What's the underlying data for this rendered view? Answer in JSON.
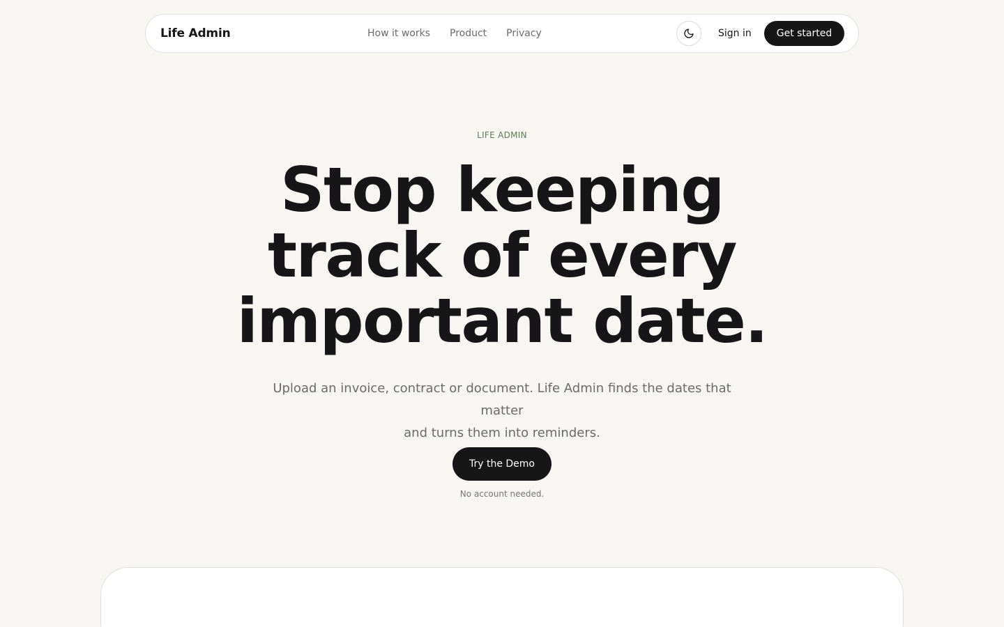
{
  "nav": {
    "brand": "Life Admin",
    "links": [
      "How it works",
      "Product",
      "Privacy"
    ],
    "theme_icon": "moon-icon",
    "sign_in": "Sign in",
    "get_started": "Get started"
  },
  "hero": {
    "eyebrow": "LIFE ADMIN",
    "headline_lines": [
      "Stop keeping",
      "track of every",
      "important date."
    ],
    "subtitle_lines": [
      "Upload an invoice, contract or document. Life Admin finds the dates that matter",
      "and turns them into reminders."
    ],
    "cta": "Try the Demo",
    "cta_note": "No account needed."
  },
  "colors": {
    "background": "#f7f6f3",
    "text": "#161616",
    "muted": "#6b6b6b",
    "accent": "#5f7a55",
    "button": "#161616"
  }
}
